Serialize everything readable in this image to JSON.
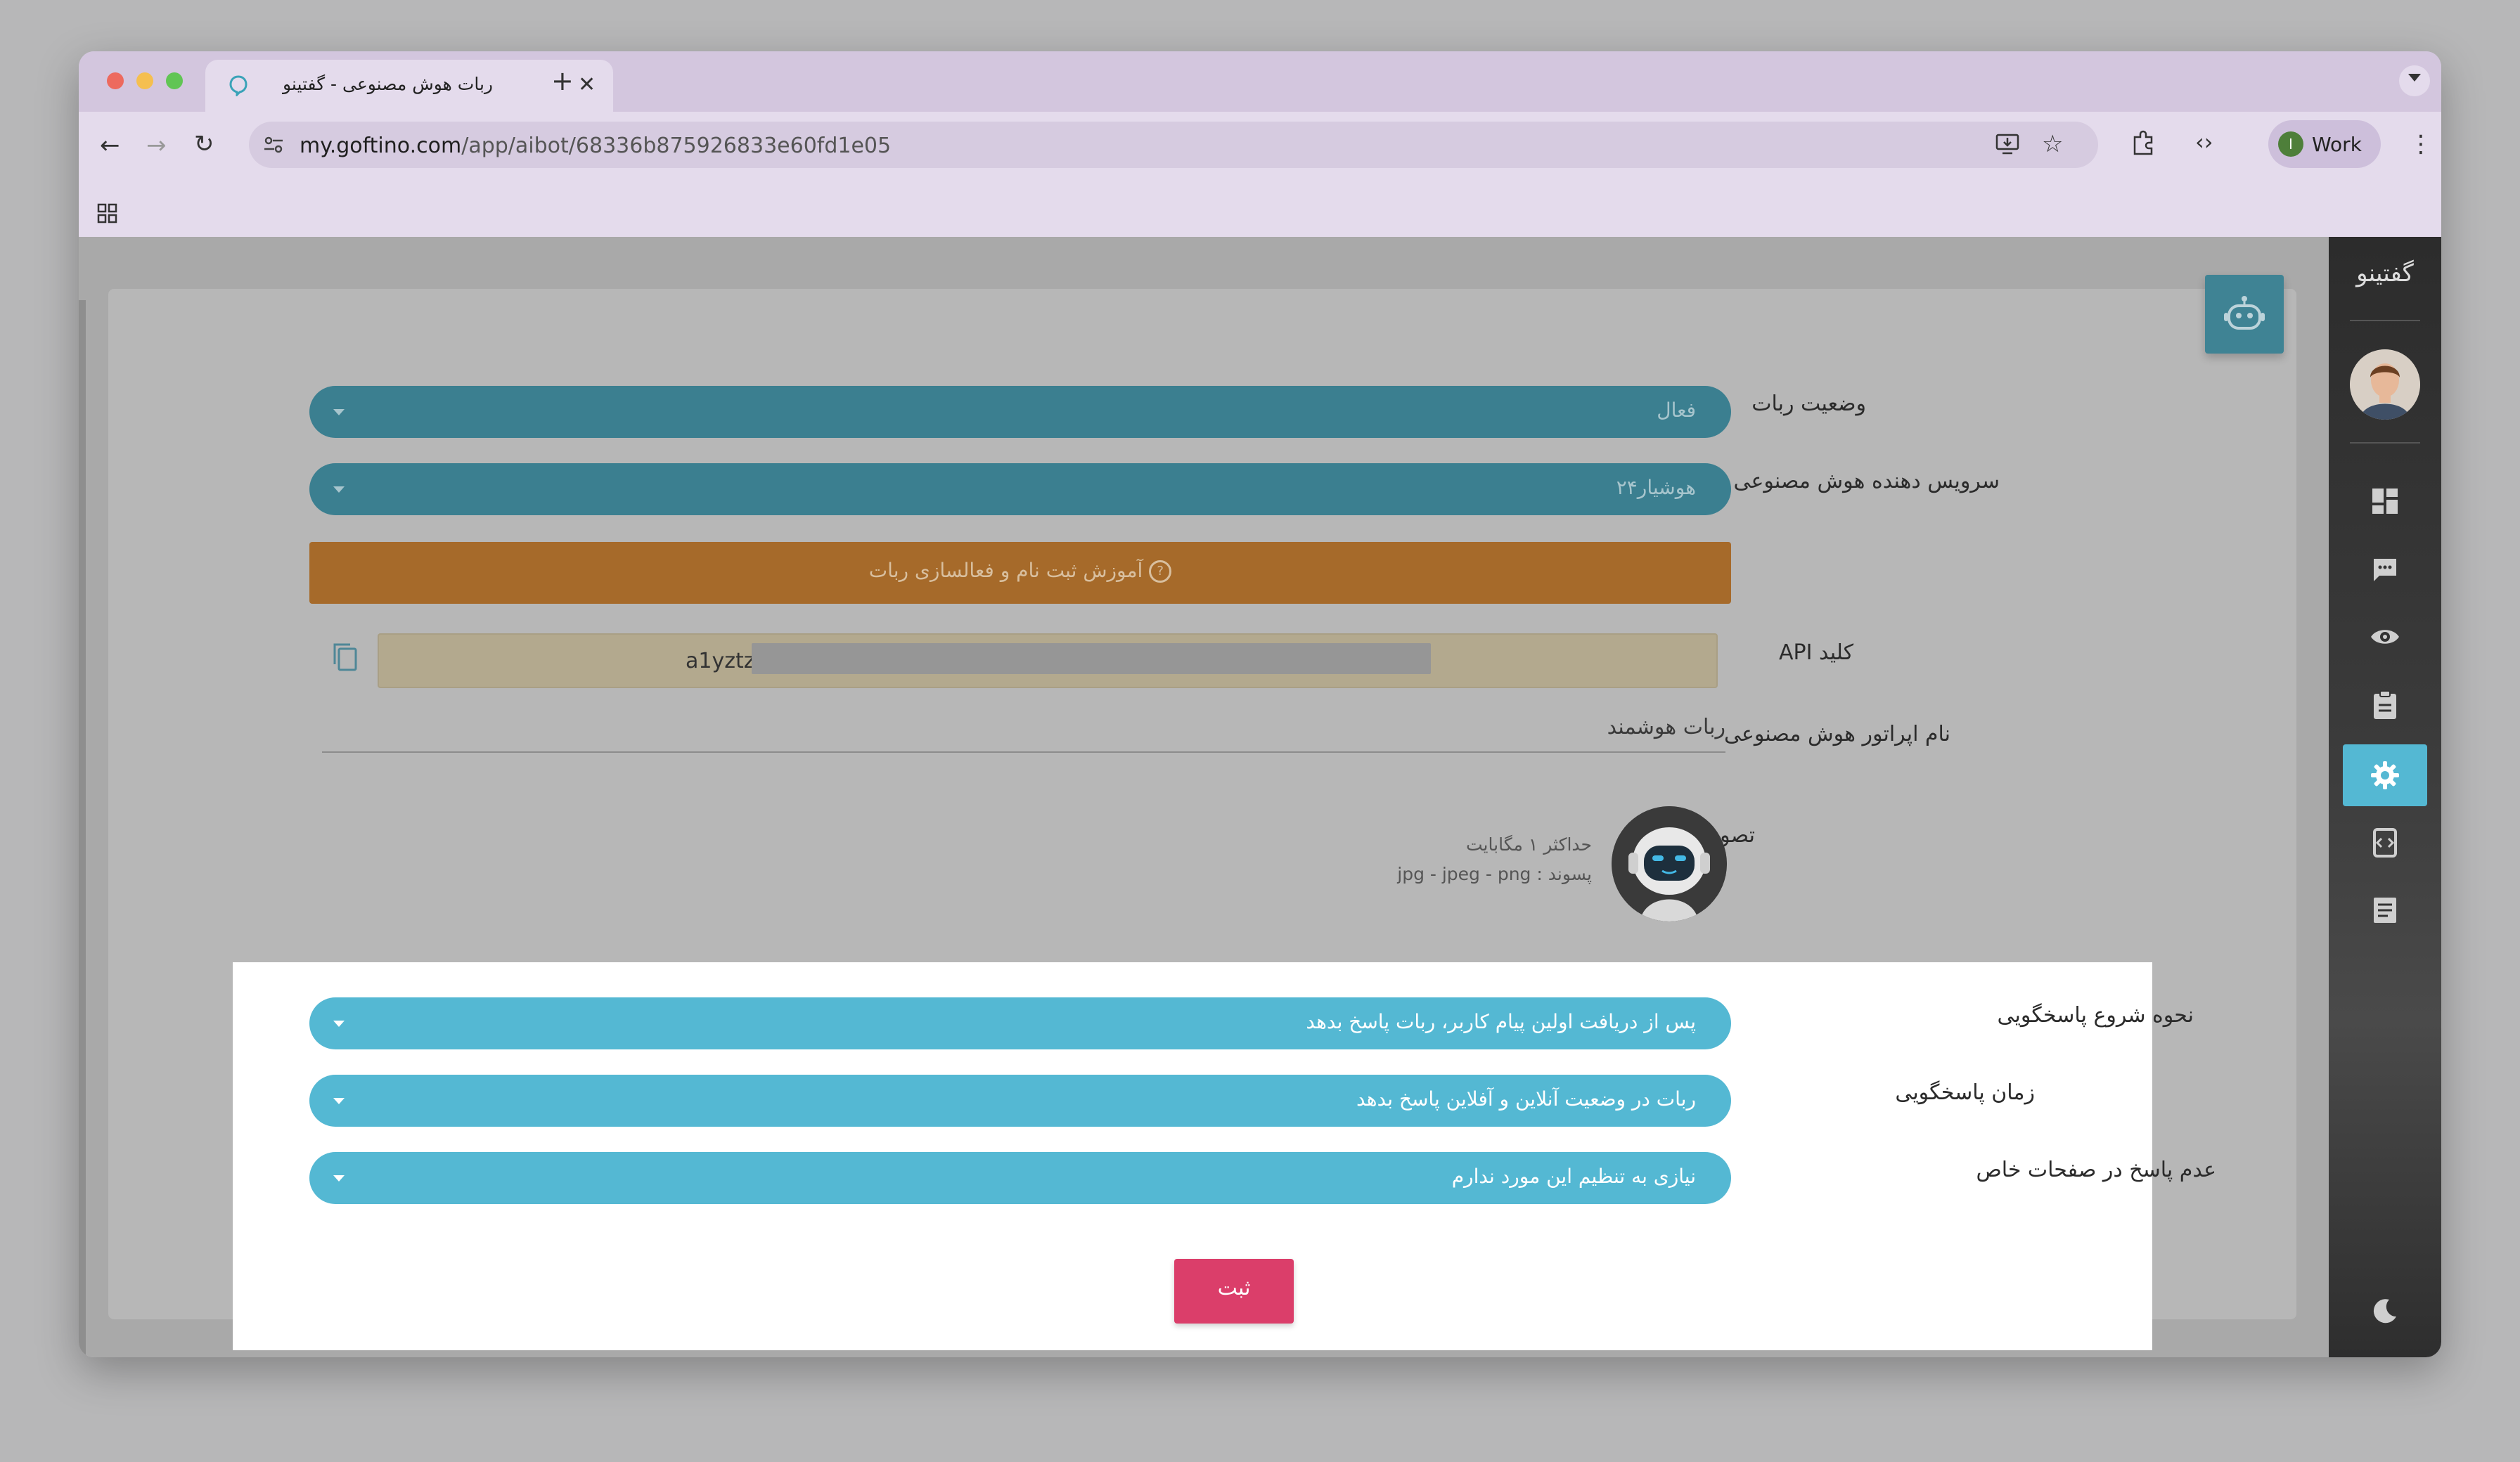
{
  "browser": {
    "tab_title": "ربات هوش مصنوعی - گفتینو",
    "url_host": "my.goftino.com",
    "url_path": "/app/aibot/68336b875926833e60fd1e05",
    "profile_label": "Work",
    "profile_initial": "I"
  },
  "sidebar": {
    "brand": "گفتینو",
    "items": [
      {
        "icon": "dashboard-icon"
      },
      {
        "icon": "chat-icon"
      },
      {
        "icon": "eye-icon"
      },
      {
        "icon": "clipboard-icon"
      },
      {
        "icon": "gear-icon",
        "active": true
      },
      {
        "icon": "code-icon"
      },
      {
        "icon": "document-icon"
      }
    ],
    "theme_toggle_icon": "moon-icon"
  },
  "form": {
    "bot_status": {
      "label": "وضعیت ربات",
      "value": "فعال"
    },
    "ai_provider": {
      "label": "سرویس دهنده هوش مصنوعی",
      "value": "هوشیار۲۴"
    },
    "tutorial_button": "آموزش ثبت نام و فعالسازی ربات",
    "api_key": {
      "label": "کلید API",
      "value": "a1yztz6"
    },
    "operator_name": {
      "label": "نام اپراتور هوش مصنوعی",
      "value": "ربات هوشمند"
    },
    "bot_image": {
      "label": "تصویر ربات",
      "hint_size": "حداکثر ۱ مگابایت",
      "hint_ext": "پسوند : jpg - jpeg - png"
    },
    "response_start": {
      "label": "نحوه شروع پاسخگویی",
      "value": "پس از دریافت اولین پیام کاربر، ربات پاسخ بدهد"
    },
    "response_time": {
      "label": "زمان پاسخگویی",
      "value": "ربات در وضعیت آنلاین و آفلاین پاسخ بدهد"
    },
    "no_response_pages": {
      "label": "عدم پاسخ در صفحات خاص",
      "value": "نیازی به تنظیم این مورد ندارم"
    },
    "submit_label": "ثبت"
  },
  "colors": {
    "teal": "#54b8d3",
    "orange": "#a66a2a",
    "submit": "#db3e6a"
  }
}
